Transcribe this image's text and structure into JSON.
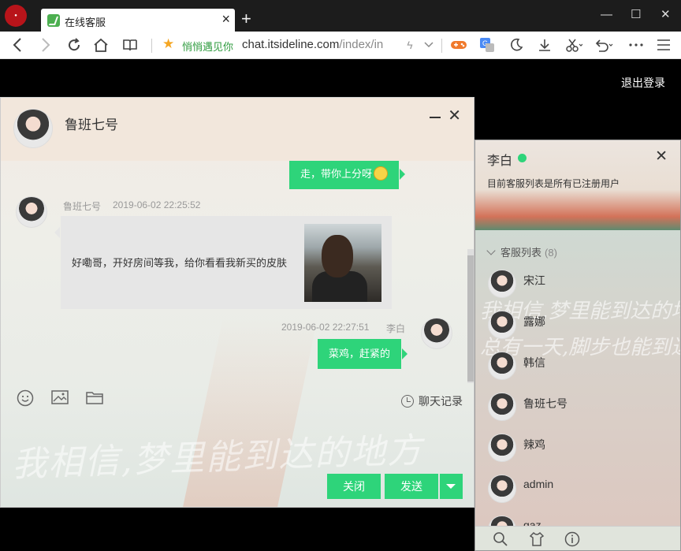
{
  "browser": {
    "tab_title": "在线客服",
    "tab_close": "×",
    "new_tab": "+",
    "bookmark_name": "悄悄遇见你",
    "url_host": "chat.itsideline.com",
    "url_path": "/index/in",
    "window_controls": [
      "—",
      "☐",
      "✕"
    ]
  },
  "page": {
    "logout": "退出登录"
  },
  "chat": {
    "title": "鲁班七号",
    "messages": [
      {
        "side": "right",
        "text": "走，带你上分呀",
        "emoji": "smiley"
      },
      {
        "side": "left",
        "sender": "鲁班七号",
        "time": "2019-06-02 22:25:52",
        "text": "好嘞哥，开好房间等我，给你看看我新买的皮肤"
      },
      {
        "side": "right",
        "sender": "李白",
        "time": "2019-06-02 22:27:51",
        "text": "菜鸡，赶紧的"
      }
    ],
    "history_label": "聊天记录",
    "close_label": "关闭",
    "send_label": "发送",
    "background_text": "我相信,梦里能到达的地方"
  },
  "panel": {
    "user_name": "李白",
    "status_color": "#2ed47a",
    "subtitle": "目前客服列表是所有已注册用户",
    "list_title": "客服列表",
    "list_count": "(8)",
    "users": [
      "宋江",
      "露娜",
      "韩信",
      "鲁班七号",
      "辣鸡",
      "admin",
      "gaz"
    ],
    "background_text": [
      "我相信,梦里能到达的地方",
      "总有一天,脚步也能到达。"
    ]
  },
  "colors": {
    "accent": "#2ed47a",
    "bookmark": "#2e9b3e"
  }
}
